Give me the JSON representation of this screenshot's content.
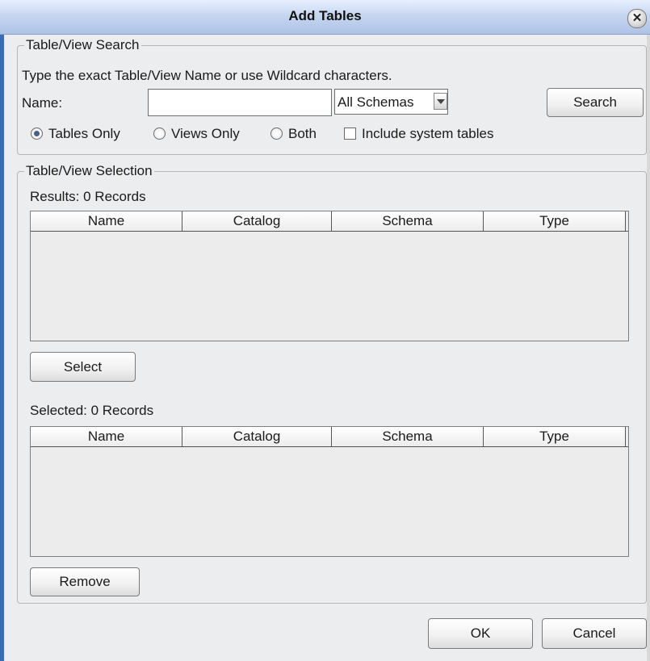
{
  "window": {
    "title": "Add Tables",
    "close_icon": "close-icon"
  },
  "search_group": {
    "legend": "Table/View Search",
    "hint": "Type the exact Table/View Name or use Wildcard characters.",
    "name_label": "Name:",
    "name_value": "",
    "schema_selected": "All Schemas",
    "search_label": "Search",
    "options": {
      "tables_only": "Tables Only",
      "views_only": "Views Only",
      "both": "Both",
      "selected": "tables_only",
      "include_system": "Include system tables",
      "include_system_checked": false
    }
  },
  "selection_group": {
    "legend": "Table/View Selection",
    "results_label": "Results:  0 Records",
    "columns": [
      "Name",
      "Catalog",
      "Schema",
      "Type"
    ],
    "results_rows": [],
    "select_label": "Select",
    "selected_label": "Selected:  0 Records",
    "selected_rows": [],
    "remove_label": "Remove"
  },
  "footer": {
    "ok_label": "OK",
    "cancel_label": "Cancel"
  }
}
